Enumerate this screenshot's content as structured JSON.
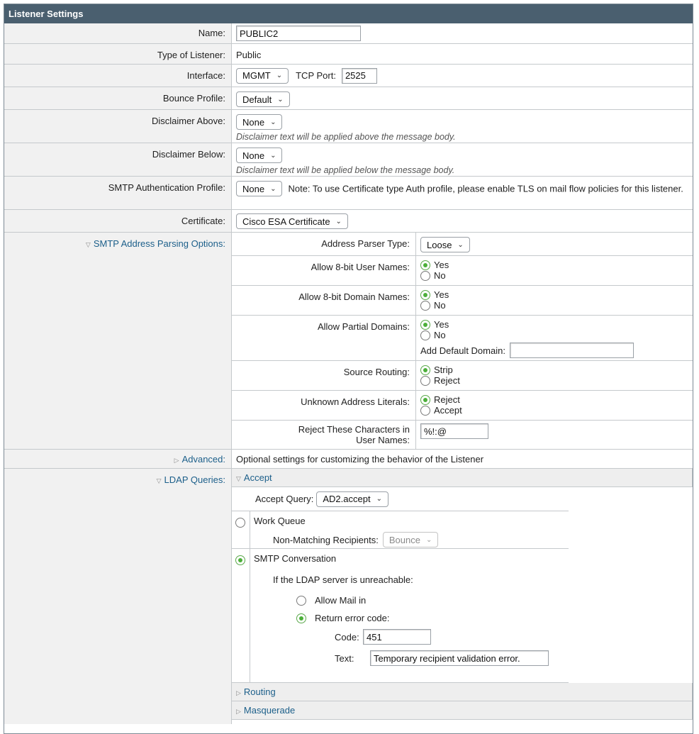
{
  "panel": {
    "title": "Listener Settings"
  },
  "name": {
    "label": "Name:",
    "value": "PUBLIC2"
  },
  "type": {
    "label": "Type of Listener:",
    "value": "Public"
  },
  "interface": {
    "label": "Interface:",
    "selected": "MGMT",
    "port_label": "TCP Port:",
    "port_value": "2525"
  },
  "bounce": {
    "label": "Bounce Profile:",
    "selected": "Default"
  },
  "disclaimer_above": {
    "label": "Disclaimer Above:",
    "selected": "None",
    "hint": "Disclaimer text will be applied above the message body."
  },
  "disclaimer_below": {
    "label": "Disclaimer Below:",
    "selected": "None",
    "hint": "Disclaimer text will be applied below the message body."
  },
  "smtp_auth": {
    "label": "SMTP Authentication Profile:",
    "selected": "None",
    "note": "Note: To use Certificate type Auth profile, please enable TLS on mail flow policies for this listener."
  },
  "certificate": {
    "label": "Certificate:",
    "selected": "Cisco ESA Certificate"
  },
  "parsing": {
    "label": "SMTP Address Parsing Options:",
    "parser_type": {
      "label": "Address Parser Type:",
      "selected": "Loose"
    },
    "user_names": {
      "label": "Allow 8-bit User Names:",
      "opt1": "Yes",
      "opt2": "No"
    },
    "domain_names": {
      "label": "Allow 8-bit Domain Names:",
      "opt1": "Yes",
      "opt2": "No"
    },
    "partial_domains": {
      "label": "Allow Partial Domains:",
      "opt1": "Yes",
      "opt2": "No",
      "default_domain_label": "Add Default Domain:",
      "default_domain_value": ""
    },
    "source_routing": {
      "label": "Source Routing:",
      "opt1": "Strip",
      "opt2": "Reject"
    },
    "unknown_literals": {
      "label": "Unknown Address Literals:",
      "opt1": "Reject",
      "opt2": "Accept"
    },
    "reject_chars": {
      "label": "Reject These Characters in User Names:",
      "value": "%!:@"
    }
  },
  "advanced": {
    "label": "Advanced:",
    "value": "Optional settings for customizing the behavior of the Listener"
  },
  "ldap": {
    "label": "LDAP Queries:",
    "accept_section": "Accept",
    "accept_query_label": "Accept Query:",
    "accept_query_selected": "AD2.accept",
    "work_queue": "Work Queue",
    "non_matching_label": "Non-Matching Recipients:",
    "non_matching_selected": "Bounce",
    "smtp_conversation": "SMTP Conversation",
    "unreachable_label": "If the LDAP server is unreachable:",
    "allow_mail": "Allow Mail in",
    "return_error": "Return error code:",
    "code_label": "Code:",
    "code_value": "451",
    "text_label": "Text:",
    "text_value": "Temporary recipient validation error.",
    "routing_section": "Routing",
    "masquerade_section": "Masquerade"
  }
}
